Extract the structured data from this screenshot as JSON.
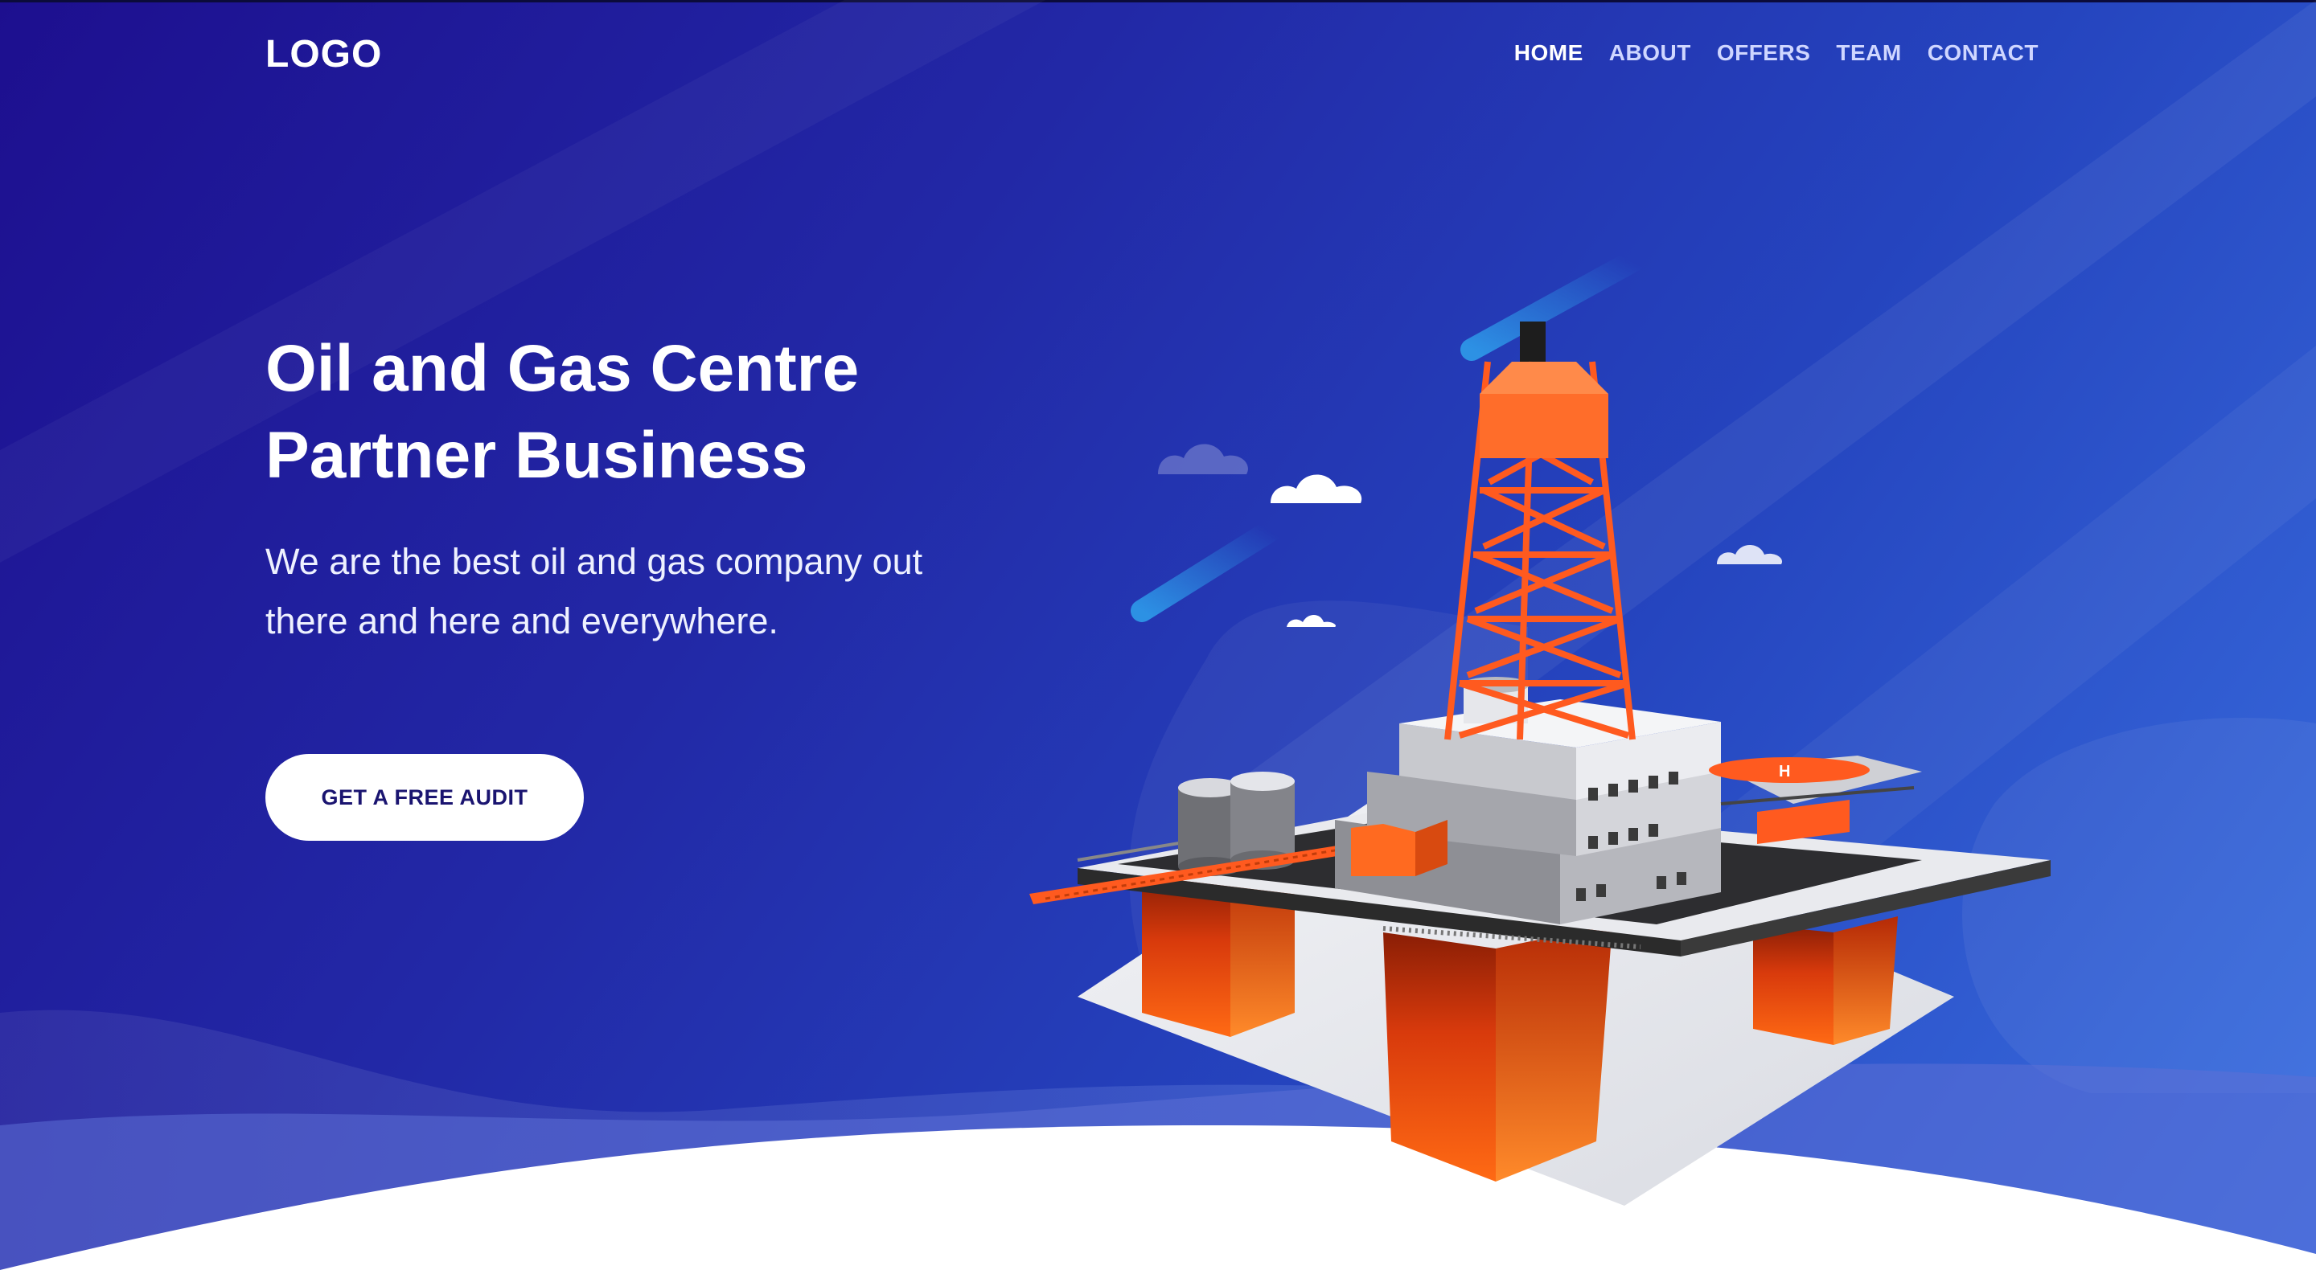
{
  "header": {
    "logo": "LOGO",
    "nav": [
      {
        "label": "HOME",
        "active": true
      },
      {
        "label": "ABOUT",
        "active": false
      },
      {
        "label": "OFFERS",
        "active": false
      },
      {
        "label": "TEAM",
        "active": false
      },
      {
        "label": "CONTACT",
        "active": false
      }
    ]
  },
  "hero": {
    "headline_line1": "Oil and Gas Centre",
    "headline_line2": "Partner Business",
    "subtext_line1": "We are the best oil and gas company out",
    "subtext_line2": "there and here and everywhere.",
    "cta_label": "GET A FREE AUDIT"
  },
  "helipad_mark": "H",
  "colors": {
    "background_start": "#1d0f8f",
    "background_end": "#3a6fe0",
    "rig_orange": "#ff5a1f",
    "button_text": "#1a1470"
  }
}
